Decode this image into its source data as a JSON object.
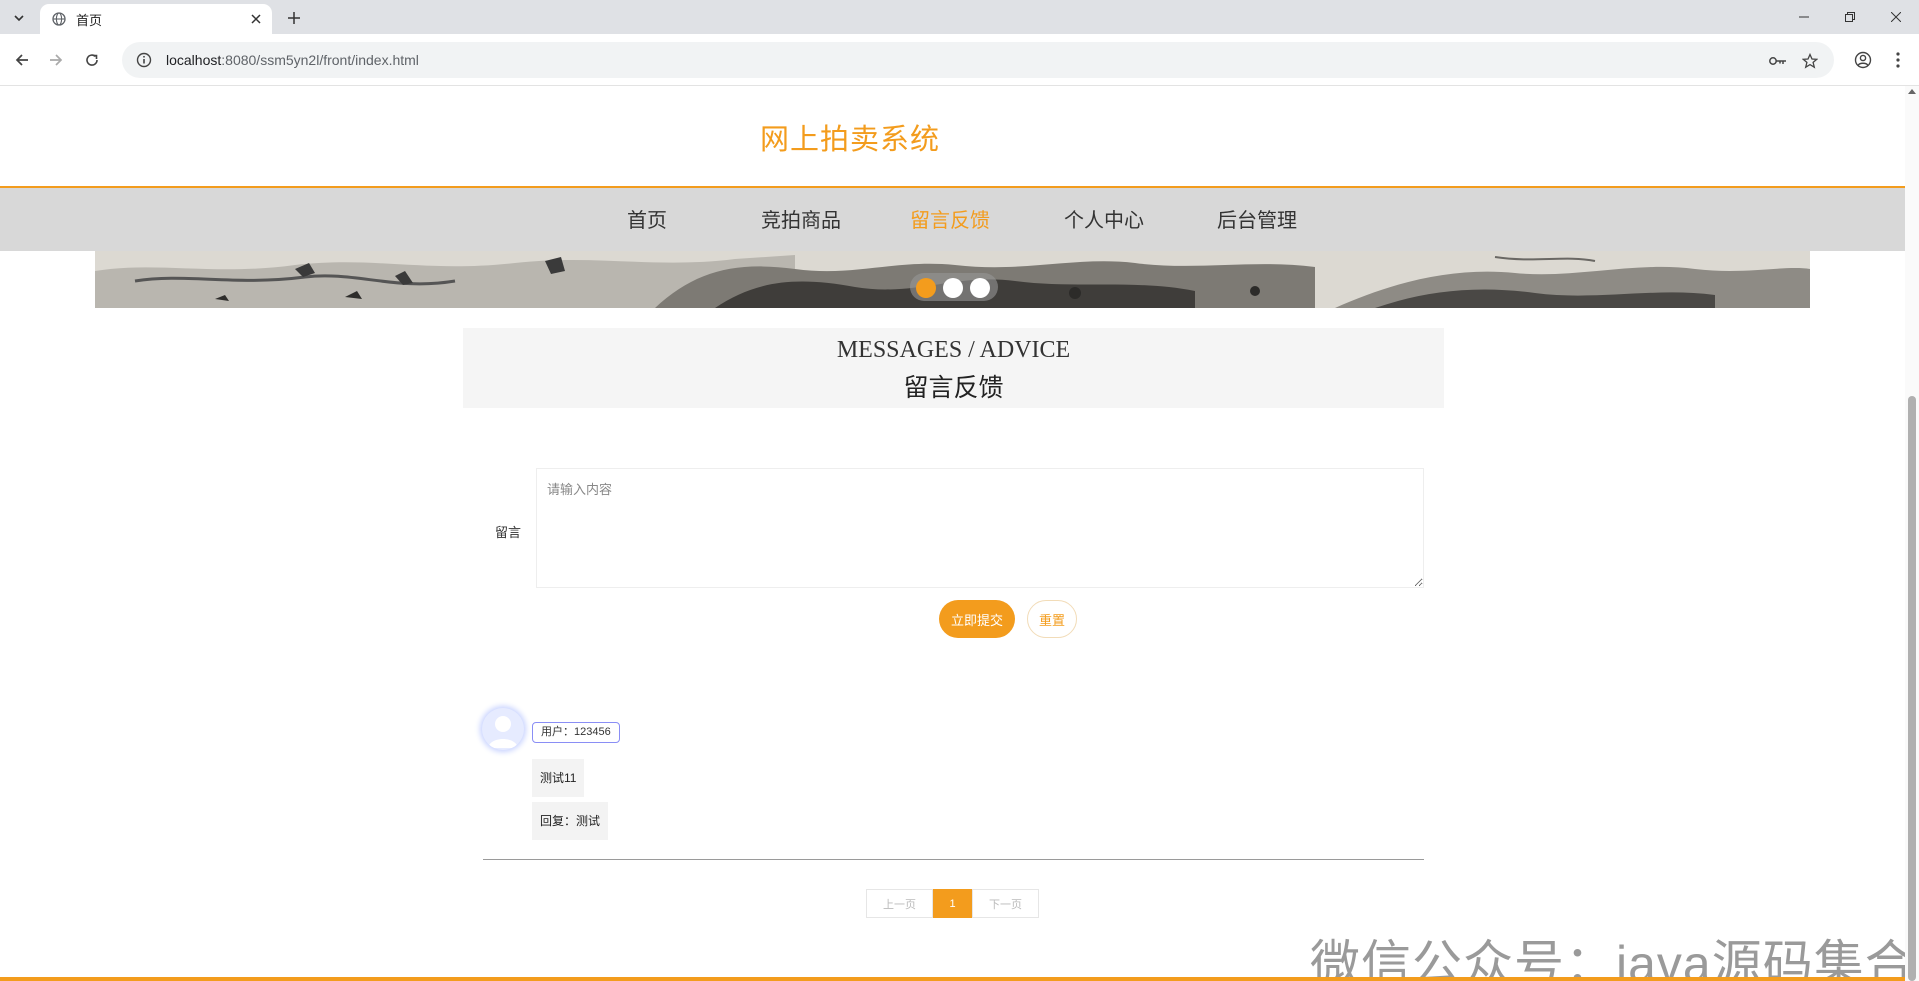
{
  "browser": {
    "tab_title": "首页",
    "url_host": "localhost",
    "url_rest": ":8080/ssm5yn2l/front/index.html"
  },
  "site": {
    "title": "网上拍卖系统",
    "nav": [
      {
        "label": "首页",
        "active": false
      },
      {
        "label": "竞拍商品",
        "active": false
      },
      {
        "label": "留言反馈",
        "active": true
      },
      {
        "label": "个人中心",
        "active": false
      },
      {
        "label": "后台管理",
        "active": false
      }
    ],
    "carousel": {
      "slides": 3,
      "active_index": 0
    }
  },
  "section": {
    "title_en": "MESSAGES / ADVICE",
    "title_cn": "留言反馈"
  },
  "form": {
    "label": "留言",
    "placeholder": "请输入内容",
    "value": "",
    "submit_label": "立即提交",
    "reset_label": "重置"
  },
  "messages": [
    {
      "user": "用户：123456",
      "content": "测试11",
      "reply": "回复：测试"
    }
  ],
  "pagination": {
    "prev_label": "上一页",
    "current": "1",
    "next_label": "下一页"
  },
  "watermark": "微信公众号：java源码集合",
  "colors": {
    "accent": "#f39c1d",
    "nav_bg": "#d8d8d8",
    "section_bg": "#f5f5f5"
  }
}
